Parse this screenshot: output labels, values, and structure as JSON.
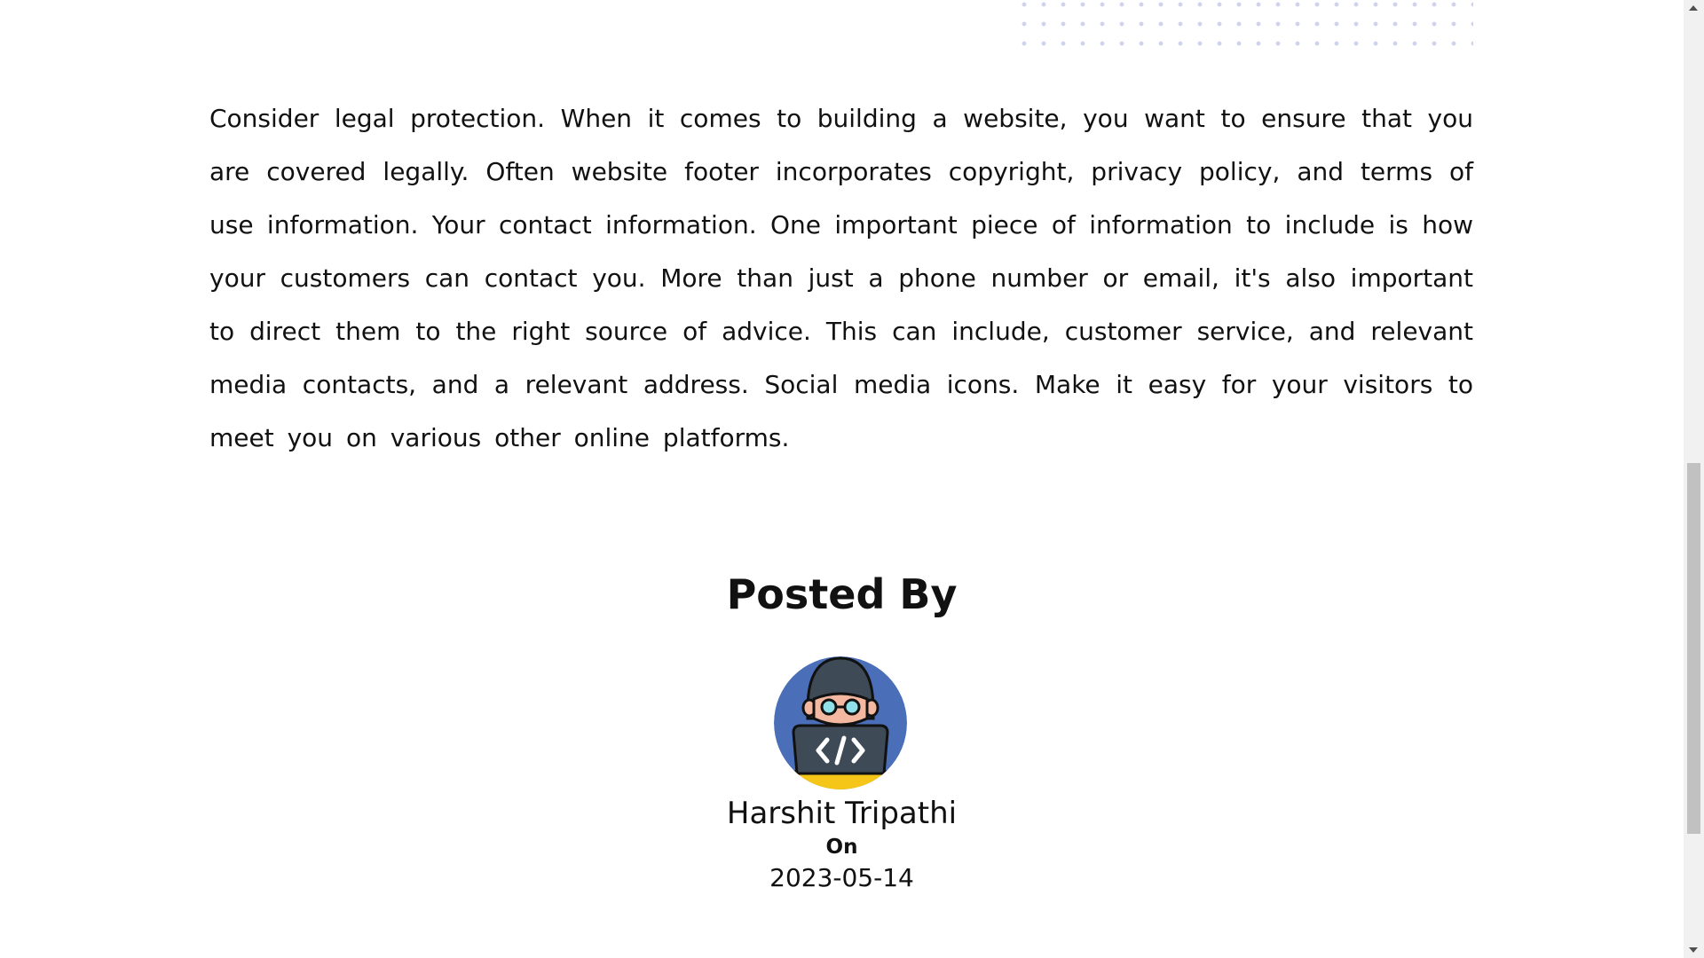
{
  "article": {
    "body": "Consider legal protection. When it comes to building a website, you want to ensure that you are covered legally. Often website footer incorporates copyright, privacy policy, and terms of use information. Your contact information. One important piece of information to include is how your customers can contact you. More than just a phone number or email, it's also important to direct them to the right source of advice. This can include, customer service, and relevant media contacts, and a relevant address. Social media icons. Make it easy for your visitors to meet you on various other online platforms."
  },
  "author": {
    "heading": "Posted By",
    "name": "Harshit Tripathi",
    "on_label": "On",
    "date": "2023-05-14",
    "avatar_icon": "developer-avatar-icon"
  },
  "colors": {
    "avatar_bg": "#4a6fb8",
    "laptop": "#3e4b57",
    "accent_yellow": "#f5c518",
    "dots": "#c9cdeb"
  }
}
